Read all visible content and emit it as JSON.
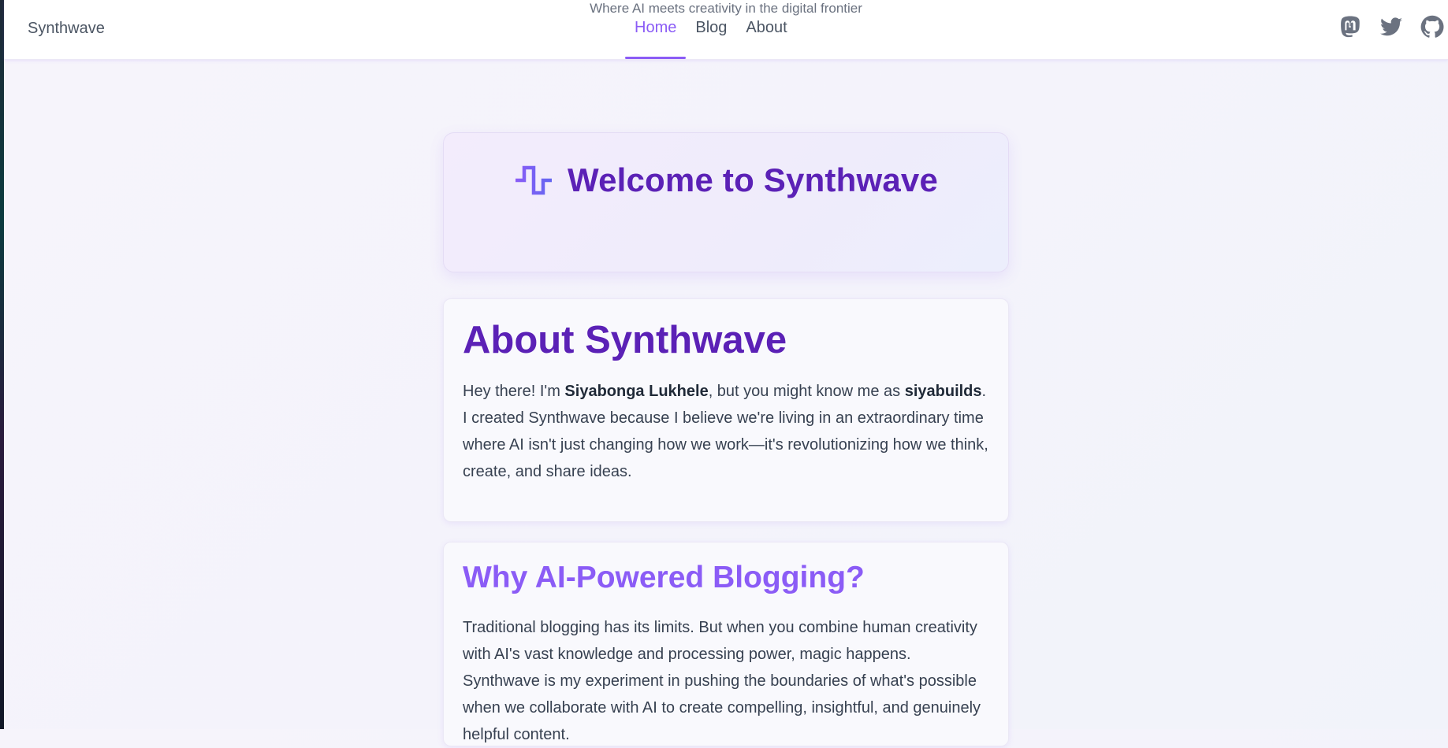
{
  "navbar": {
    "brand": "Synthwave",
    "links": [
      {
        "label": "Home",
        "active": true
      },
      {
        "label": "Blog",
        "active": false
      },
      {
        "label": "About",
        "active": false
      }
    ],
    "social_icons": [
      "mastodon-icon",
      "twitter-icon",
      "github-icon"
    ]
  },
  "hero": {
    "icon": "pulse-wave-icon",
    "title": "Welcome to Synthwave",
    "subtitle": "Where AI meets creativity in the digital frontier"
  },
  "about": {
    "heading": "About Synthwave",
    "intro_1": "Hey there! I'm ",
    "name": "Siyabonga Lukhele",
    "intro_2": ", but you might know me as ",
    "handle": "siyabuilds",
    "intro_3": ". I created Synthwave because I believe we're living in an extraordinary time where AI isn't just changing how we work—it's revolutionizing how we think, create, and share ideas."
  },
  "why": {
    "heading": "Why AI-Powered Blogging?",
    "paragraph": "Traditional blogging has its limits. But when you combine human creativity with AI's vast knowledge and processing power, magic happens. Synthwave is my experiment in pushing the boundaries of what's possible when we collaborate with AI to create compelling, insightful, and genuinely helpful content."
  },
  "colors": {
    "accent": "#8b5cf6",
    "heading_dark": "#5b21b6",
    "text": "#374151"
  }
}
